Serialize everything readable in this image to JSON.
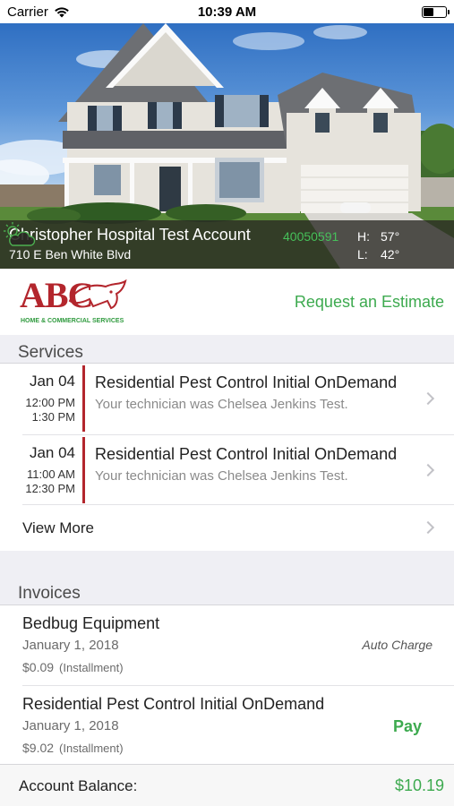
{
  "status_bar": {
    "carrier": "Carrier",
    "time": "10:39 AM"
  },
  "account": {
    "name": "Christopher Hospital Test Account",
    "number": "40050591",
    "address": "710 E Ben White Blvd"
  },
  "weather": {
    "high_label": "H:",
    "high": "57°",
    "low_label": "L:",
    "low": "42°",
    "icon": "partly-cloudy-icon"
  },
  "brand": {
    "logo_text": "ABC",
    "logo_subtitle": "HOME & COMMERCIAL SERVICES",
    "request_estimate": "Request an Estimate"
  },
  "services": {
    "header": "Services",
    "items": [
      {
        "date": "Jan 04",
        "start": "12:00 PM",
        "end": "1:30 PM",
        "title": "Residential Pest Control Initial OnDemand",
        "subtitle": "Your technician was Chelsea Jenkins Test."
      },
      {
        "date": "Jan 04",
        "start": "11:00 AM",
        "end": "12:30 PM",
        "title": "Residential Pest Control Initial OnDemand",
        "subtitle": "Your technician was Chelsea Jenkins Test."
      }
    ],
    "view_more": "View More"
  },
  "invoices": {
    "header": "Invoices",
    "items": [
      {
        "title": "Bedbug Equipment",
        "date": "January 1, 2018",
        "amount": "$0.09",
        "note": "(Installment)",
        "status": "Auto Charge"
      },
      {
        "title": "Residential Pest Control Initial OnDemand",
        "date": "January 1, 2018",
        "amount": "$9.02",
        "note": "(Installment)",
        "action": "Pay"
      }
    ]
  },
  "balance": {
    "label": "Account Balance:",
    "value": "$10.19"
  },
  "colors": {
    "accent_green": "#3daa4f",
    "account_number_green": "#46c05a",
    "brand_red": "#b3262d"
  }
}
